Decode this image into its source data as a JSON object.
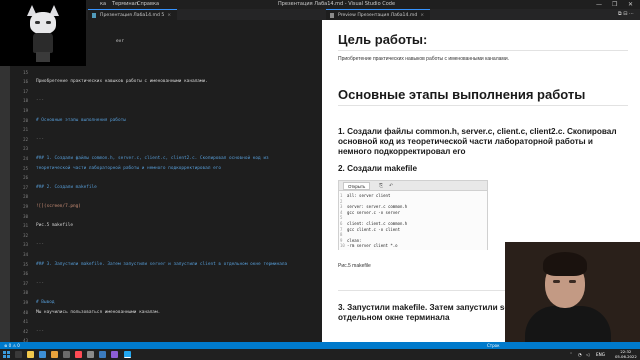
{
  "title_bar": {
    "menu": [
      "ка",
      "Терминал",
      "Справка"
    ],
    "window_title": "Презентация Лаба14.md - Visual Studio Code",
    "controls": [
      "—",
      "❐",
      "✕"
    ]
  },
  "editor_tab": {
    "label": "Презентация Лаба14.md 5",
    "close": "×"
  },
  "preview_tab": {
    "label": "Preview Презентация Лаба14.md",
    "close": "×",
    "actions": "⧉ ⊟ ⋯"
  },
  "webcam_top": {
    "partial_text": "evr"
  },
  "gutter_lines": [
    "14",
    "15",
    "16",
    "17",
    "18",
    "19",
    "20",
    "21",
    "22",
    "23",
    "24",
    "25",
    "26",
    "27",
    "28",
    "29",
    "30",
    "31",
    "32",
    "33",
    "34",
    "35",
    "36",
    "37",
    "38",
    "39",
    "40",
    "41",
    "42",
    "43",
    "44",
    "45"
  ],
  "editor_lines": [
    {
      "text": "# Цель работы:",
      "kind": "head"
    },
    {
      "text": "",
      "kind": "text"
    },
    {
      "text": "Приобретение практических навыков работы с именованными каналами.",
      "kind": "text"
    },
    {
      "text": "",
      "kind": "text"
    },
    {
      "text": "---",
      "kind": "sep"
    },
    {
      "text": "",
      "kind": "text"
    },
    {
      "text": "# Основные этапы выполнения работы",
      "kind": "head"
    },
    {
      "text": "",
      "kind": "text"
    },
    {
      "text": "---",
      "kind": "sep"
    },
    {
      "text": "",
      "kind": "text"
    },
    {
      "text": "### 1. Создали файлы common.h, server.c, client.c, client2.c. Скопировал основной код из",
      "kind": "head"
    },
    {
      "text": "теоретической части лабораторной работы и немного подкорректировал его",
      "kind": "head"
    },
    {
      "text": "",
      "kind": "text"
    },
    {
      "text": "### 2. Создали makefile",
      "kind": "head"
    },
    {
      "text": "",
      "kind": "text"
    },
    {
      "text": "![](screen/7.png)",
      "kind": "link"
    },
    {
      "text": "",
      "kind": "text"
    },
    {
      "text": "Рис.5 makefile",
      "kind": "text"
    },
    {
      "text": "",
      "kind": "text"
    },
    {
      "text": "---",
      "kind": "sep"
    },
    {
      "text": "",
      "kind": "text"
    },
    {
      "text": "### 3.  Запустили makefile. Затем запустили server и запустили client в отдельном окне терминала",
      "kind": "head"
    },
    {
      "text": "",
      "kind": "text"
    },
    {
      "text": "---",
      "kind": "sep"
    },
    {
      "text": "",
      "kind": "text"
    },
    {
      "text": "# Вывод",
      "kind": "head"
    },
    {
      "text": "Мы научились пользоваться именованными каналам.",
      "kind": "text"
    },
    {
      "text": "",
      "kind": "text"
    },
    {
      "text": "---",
      "kind": "sep"
    },
    {
      "text": "",
      "kind": "text"
    },
    {
      "text": "# Спасибо за внимание",
      "kind": "head"
    },
    {
      "text": "",
      "kind": "text"
    }
  ],
  "preview": {
    "goal_title": "Цель работы:",
    "goal_body": "Приобретение практических навыков работы с именованными каналами.",
    "stages_title": "Основные этапы выполнения работы",
    "step1": "1. Создали файлы common.h, server.c, client.c, client2.c. Скопировал основной код из теоретической части лабораторной работы и немного подкорректировал его",
    "step2": "2. Создали makefile",
    "image": {
      "open_button": "Открыть",
      "code_lines": [
        "all: server client",
        "",
        "server: server.c common.h",
        "        gcc server.c -o server",
        "",
        "client: client.c common.h",
        "        gcc client.c -o client",
        "",
        "clean:",
        "        -rm server client *.o"
      ]
    },
    "caption": "Рис.5 makefile",
    "step3": "3. Запустили makefile. Затем запустили se",
    "step3_line2": "отдельном окне терминала"
  },
  "status_bar": {
    "left": "⊗ 0 ⚠ 0",
    "right": "Строк"
  },
  "taskbar": {
    "lang": "ENG",
    "time": "22:32",
    "date": "05.06.2022"
  },
  "colors": {
    "accent": "#007acc",
    "editor_bg": "#1e1e1e",
    "heading": "#569cd6"
  }
}
